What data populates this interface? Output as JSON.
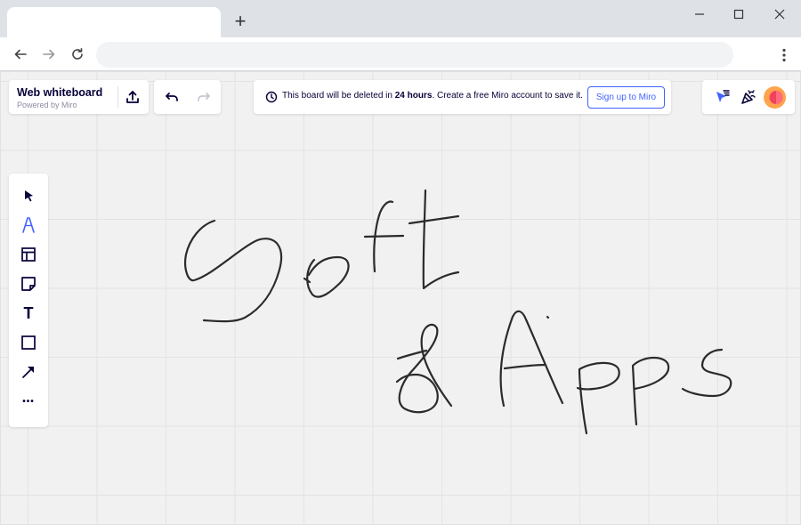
{
  "browser": {
    "new_tab_label": "+",
    "window_controls": [
      "minimize-icon",
      "maximize-icon",
      "close-icon"
    ],
    "nav": [
      "back-arrow-icon",
      "forward-arrow-icon",
      "reload-icon"
    ],
    "address": ""
  },
  "board": {
    "title": "Web whiteboard",
    "subtitle": "Powered by Miro",
    "banner_prefix": "This board will be deleted in",
    "banner_bold": "24 hours",
    "banner_suffix": ". Create a free Miro account to save it.",
    "signup_label": "Sign up to Miro",
    "tools": [
      "select-cursor-icon",
      "pen-icon",
      "templates-icon",
      "sticky-note-icon",
      "text-icon",
      "shape-icon",
      "line-arrow-icon",
      "more-icon"
    ],
    "text_tool_glyph": "T",
    "more_tool_glyph": "•••",
    "colors": {
      "accent": "#4262ff",
      "ink": "#050038",
      "board_bg": "#f1f1f1",
      "grid": "#e3e3e3",
      "stroke": "#2b2b2b"
    }
  }
}
